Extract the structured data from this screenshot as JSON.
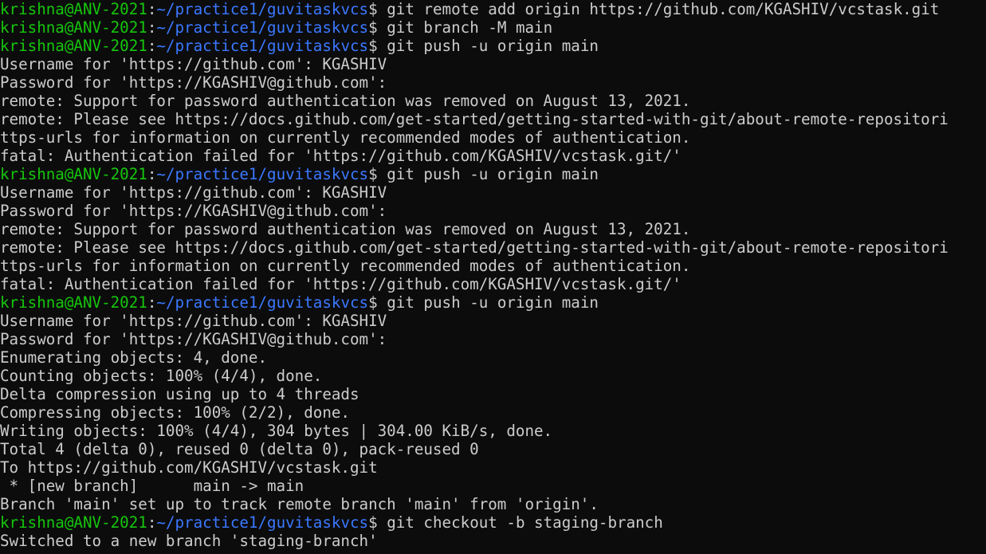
{
  "colors": {
    "background": "#0c0c0c",
    "foreground": "#cccccc",
    "prompt_user": "#16c60c",
    "prompt_path": "#3b78ff"
  },
  "prompt": {
    "user_host": "krishna@ANV-2021",
    "separator": ":",
    "path": "~/practice1/guvitaskvcs",
    "symbol": "$"
  },
  "lines": [
    {
      "type": "cmd",
      "text": " git remote add origin https://github.com/KGASHIV/vcstask.git"
    },
    {
      "type": "cmd",
      "text": " git branch -M main"
    },
    {
      "type": "cmd",
      "text": " git push -u origin main"
    },
    {
      "type": "out",
      "text": "Username for 'https://github.com': KGASHIV"
    },
    {
      "type": "out",
      "text": "Password for 'https://KGASHIV@github.com':"
    },
    {
      "type": "out",
      "text": "remote: Support for password authentication was removed on August 13, 2021."
    },
    {
      "type": "out",
      "text": "remote: Please see https://docs.github.com/get-started/getting-started-with-git/about-remote-repositori"
    },
    {
      "type": "out",
      "text": "ttps-urls for information on currently recommended modes of authentication."
    },
    {
      "type": "out",
      "text": "fatal: Authentication failed for 'https://github.com/KGASHIV/vcstask.git/'"
    },
    {
      "type": "cmd",
      "text": " git push -u origin main"
    },
    {
      "type": "out",
      "text": "Username for 'https://github.com': KGASHIV"
    },
    {
      "type": "out",
      "text": "Password for 'https://KGASHIV@github.com':"
    },
    {
      "type": "out",
      "text": "remote: Support for password authentication was removed on August 13, 2021."
    },
    {
      "type": "out",
      "text": "remote: Please see https://docs.github.com/get-started/getting-started-with-git/about-remote-repositori"
    },
    {
      "type": "out",
      "text": "ttps-urls for information on currently recommended modes of authentication."
    },
    {
      "type": "out",
      "text": "fatal: Authentication failed for 'https://github.com/KGASHIV/vcstask.git/'"
    },
    {
      "type": "cmd",
      "text": " git push -u origin main"
    },
    {
      "type": "out",
      "text": "Username for 'https://github.com': KGASHIV"
    },
    {
      "type": "out",
      "text": "Password for 'https://KGASHIV@github.com':"
    },
    {
      "type": "out",
      "text": "Enumerating objects: 4, done."
    },
    {
      "type": "out",
      "text": "Counting objects: 100% (4/4), done."
    },
    {
      "type": "out",
      "text": "Delta compression using up to 4 threads"
    },
    {
      "type": "out",
      "text": "Compressing objects: 100% (2/2), done."
    },
    {
      "type": "out",
      "text": "Writing objects: 100% (4/4), 304 bytes | 304.00 KiB/s, done."
    },
    {
      "type": "out",
      "text": "Total 4 (delta 0), reused 0 (delta 0), pack-reused 0"
    },
    {
      "type": "out",
      "text": "To https://github.com/KGASHIV/vcstask.git"
    },
    {
      "type": "out",
      "text": " * [new branch]      main -> main"
    },
    {
      "type": "out",
      "text": "Branch 'main' set up to track remote branch 'main' from 'origin'."
    },
    {
      "type": "cmd",
      "text": " git checkout -b staging-branch"
    },
    {
      "type": "out",
      "text": "Switched to a new branch 'staging-branch'"
    }
  ]
}
